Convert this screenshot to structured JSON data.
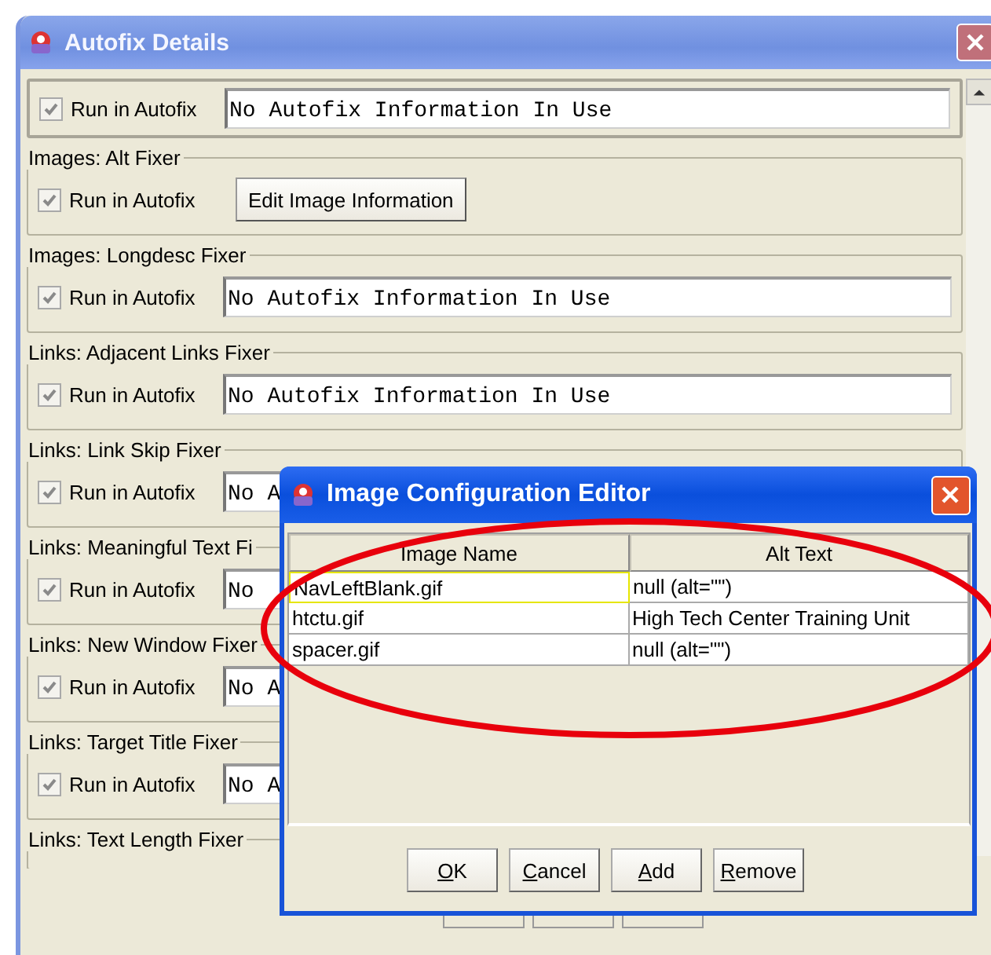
{
  "window": {
    "title": "Autofix Details"
  },
  "groups": [
    {
      "kind": "field",
      "checkbox_label": "Run in Autofix",
      "checked": true,
      "value": "No Autofix Information In Use"
    },
    {
      "legend": "Images: Alt Fixer",
      "kind": "button",
      "checkbox_label": "Run in Autofix",
      "checked": true,
      "value": "Edit Image Information"
    },
    {
      "legend": "Images: Longdesc Fixer",
      "kind": "field",
      "checkbox_label": "Run in Autofix",
      "checked": true,
      "value": "No Autofix Information In Use"
    },
    {
      "legend": "Links: Adjacent Links Fixer",
      "kind": "field",
      "checkbox_label": "Run in Autofix",
      "checked": true,
      "value": "No Autofix Information In Use"
    },
    {
      "legend": "Links: Link Skip Fixer",
      "kind": "field",
      "checkbox_label": "Run in Autofix",
      "checked": true,
      "value": "No A"
    },
    {
      "legend": "Links: Meaningful Text Fi",
      "kind": "field",
      "checkbox_label": "Run in Autofix",
      "checked": true,
      "value": "No"
    },
    {
      "legend": "Links: New Window Fixer",
      "kind": "field",
      "checkbox_label": "Run in Autofix",
      "checked": true,
      "value": "No A"
    },
    {
      "legend": "Links: Target Title Fixer",
      "kind": "field",
      "checkbox_label": "Run in Autofix",
      "checked": true,
      "value": "No A"
    },
    {
      "legend": "Links: Text Length Fixer"
    }
  ],
  "dialog": {
    "title": "Image Configuration Editor",
    "columns": [
      "Image Name",
      "Alt Text"
    ],
    "rows": [
      {
        "cells": [
          "NavLeftBlank.gif",
          "null (alt=\"\")"
        ],
        "selected": true
      },
      {
        "cells": [
          "htctu.gif",
          "High Tech Center Training Unit"
        ],
        "selected": false
      },
      {
        "cells": [
          "spacer.gif",
          "null (alt=\"\")"
        ],
        "selected": false
      }
    ],
    "buttons": [
      "OK",
      "Cancel",
      "Add",
      "Remove"
    ]
  }
}
